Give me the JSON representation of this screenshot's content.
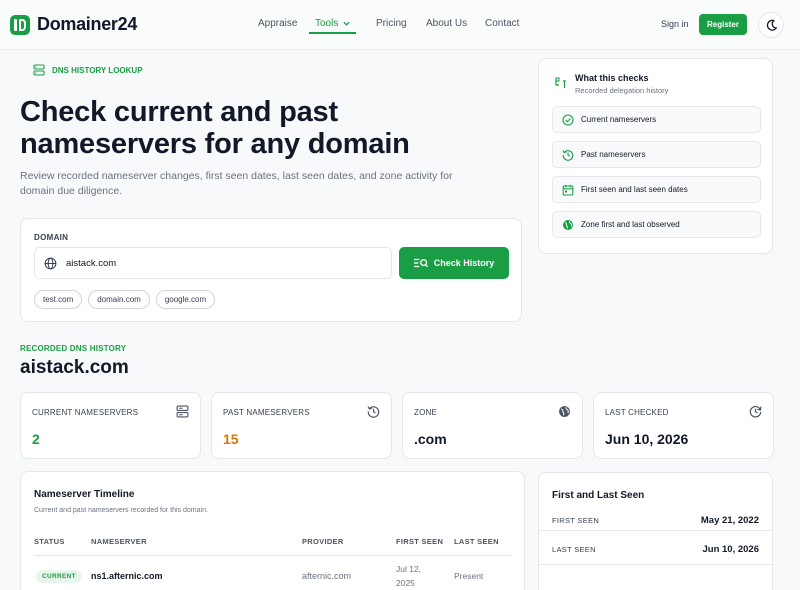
{
  "brand": {
    "name": "Domainer24",
    "accent": "#1a9e45"
  },
  "nav": {
    "links": [
      "Appraise",
      "Tools",
      "Pricing",
      "About Us",
      "Contact"
    ],
    "active": "Tools",
    "signin": "Sign in",
    "register": "Register",
    "theme_icon": "moon-icon"
  },
  "hero": {
    "eyebrow": "DNS HISTORY LOOKUP",
    "title": "Check current and past nameservers for any domain",
    "subtitle": "Review recorded nameserver changes, first seen dates, last seen dates, and zone activity for domain due diligence."
  },
  "search": {
    "label": "DOMAIN",
    "value": "aistack.com",
    "button": "Check History",
    "suggestions": [
      "test.com",
      "domain.com",
      "google.com"
    ]
  },
  "checks": {
    "title": "What this checks",
    "subtitle": "Recorded delegation history",
    "items": [
      {
        "label": "Current nameservers",
        "icon": "check-circle-icon"
      },
      {
        "label": "Past nameservers",
        "icon": "history-icon"
      },
      {
        "label": "First seen and last seen dates",
        "icon": "calendar-icon"
      },
      {
        "label": "Zone first and last observed",
        "icon": "globe-icon"
      }
    ]
  },
  "results": {
    "eyebrow": "RECORDED DNS HISTORY",
    "domain": "aistack.com",
    "stats": [
      {
        "label": "CURRENT NAMESERVERS",
        "value": "2",
        "color": "#1a9e45",
        "icon": "server-icon"
      },
      {
        "label": "PAST NAMESERVERS",
        "value": "15",
        "color": "#d97706",
        "icon": "history-icon"
      },
      {
        "label": "ZONE",
        "value": ".com",
        "color": "#111827",
        "icon": "globe-icon"
      },
      {
        "label": "LAST CHECKED",
        "value": "Jun 10, 2026",
        "color": "#111827",
        "icon": "clock-refresh-icon"
      }
    ]
  },
  "timeline": {
    "title": "Nameserver Timeline",
    "subtitle": "Current and past nameservers recorded for this domain.",
    "columns": [
      "STATUS",
      "NAMESERVER",
      "PROVIDER",
      "FIRST SEEN",
      "LAST SEEN"
    ],
    "rows": [
      {
        "status": "CURRENT",
        "nameserver": "ns1.afternic.com",
        "provider": "afternic.com",
        "first_seen_1": "Jul 12,",
        "first_seen_2": "2025",
        "last_seen": "Present"
      }
    ]
  },
  "first_last": {
    "title": "First and Last Seen",
    "first_label": "FIRST SEEN",
    "first_value": "May 21, 2022",
    "last_label": "LAST SEEN",
    "last_value": "Jun 10, 2026"
  }
}
